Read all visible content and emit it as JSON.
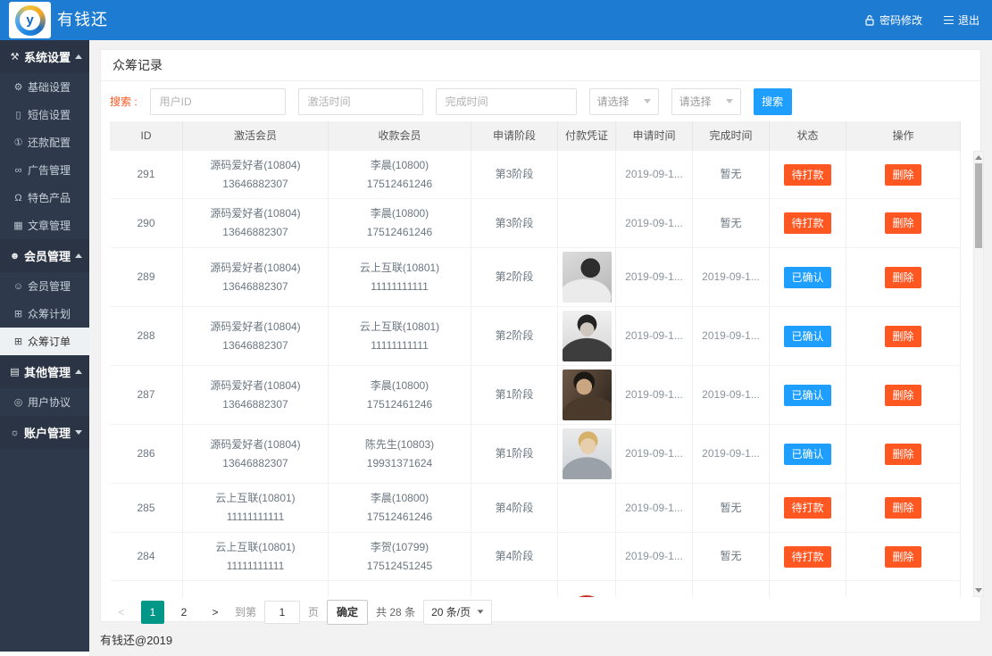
{
  "colors": {
    "header_bg": "#1E7BD2",
    "sidebar_bg": "#2E3A4C",
    "accent_blue": "#1E9FFF",
    "danger_orange": "#FF5722",
    "pager_green": "#009688"
  },
  "header": {
    "title": "有钱还",
    "logo_letter": "y",
    "password_label": "密码修改",
    "logout_label": "退出"
  },
  "sidebar": {
    "groups": [
      {
        "label": "系统设置",
        "icon": "tools-icon",
        "glyph": "⚒",
        "children": [
          {
            "label": "基础设置",
            "icon": "gear-icon",
            "glyph": "⚙"
          },
          {
            "label": "短信设置",
            "icon": "phone-icon",
            "glyph": "▯"
          },
          {
            "label": "还款配置",
            "icon": "repayment-icon",
            "glyph": "①"
          },
          {
            "label": "广告管理",
            "icon": "link-icon",
            "glyph": "∞"
          },
          {
            "label": "特色产品",
            "icon": "bell-icon",
            "glyph": "Ω"
          },
          {
            "label": "文章管理",
            "icon": "articles-icon",
            "glyph": "▦"
          }
        ]
      },
      {
        "label": "会员管理",
        "icon": "members-icon",
        "glyph": "☻",
        "children": [
          {
            "label": "会员管理",
            "icon": "user-icon",
            "glyph": "☺"
          },
          {
            "label": "众筹计划",
            "icon": "plan-icon",
            "glyph": "⊞"
          },
          {
            "label": "众筹订单",
            "icon": "orders-icon",
            "glyph": "⊞",
            "active": true
          }
        ]
      },
      {
        "label": "其他管理",
        "icon": "other-icon",
        "glyph": "▤",
        "children": [
          {
            "label": "用户协议",
            "icon": "agreement-icon",
            "glyph": "◎"
          }
        ]
      },
      {
        "label": "账户管理",
        "icon": "account-icon",
        "glyph": "☼",
        "children": []
      }
    ]
  },
  "main": {
    "page_title": "众筹记录",
    "search": {
      "label": "搜索 :",
      "fields": [
        {
          "placeholder": "用户ID"
        },
        {
          "placeholder": "激活时间"
        },
        {
          "placeholder": "完成时间"
        }
      ],
      "selects": [
        {
          "value": "请选择"
        },
        {
          "value": "请选择"
        }
      ],
      "button": "搜索"
    },
    "table": {
      "columns": [
        "ID",
        "激活会员",
        "收款会员",
        "申请阶段",
        "付款凭证",
        "申请时间",
        "完成时间",
        "状态",
        "操作"
      ],
      "rows": [
        {
          "id": "291",
          "activator_name": "源码爱好者(10804)",
          "activator_phone": "13646882307",
          "payee_name": "李晨(10800)",
          "payee_phone": "17512461246",
          "stage": "第3阶段",
          "apply_time": "2019-09-1...",
          "finish_time": "暂无",
          "status_label": "待打款",
          "status_class": "badge badge-orange",
          "action_label": "删除"
        },
        {
          "id": "290",
          "activator_name": "源码爱好者(10804)",
          "activator_phone": "13646882307",
          "payee_name": "李晨(10800)",
          "payee_phone": "17512461246",
          "stage": "第3阶段",
          "apply_time": "2019-09-1...",
          "finish_time": "暂无",
          "status_label": "待打款",
          "status_class": "badge badge-orange",
          "action_label": "删除"
        },
        {
          "id": "289",
          "activator_name": "源码爱好者(10804)",
          "activator_phone": "13646882307",
          "payee_name": "云上互联(10801)",
          "payee_phone": "11111111111",
          "stage": "第2阶段",
          "voucher_class": "photo photo-a",
          "apply_time": "2019-09-1...",
          "finish_time": "2019-09-1...",
          "status_label": "已确认",
          "status_class": "badge badge-blue",
          "action_label": "删除"
        },
        {
          "id": "288",
          "activator_name": "源码爱好者(10804)",
          "activator_phone": "13646882307",
          "payee_name": "云上互联(10801)",
          "payee_phone": "11111111111",
          "stage": "第2阶段",
          "voucher_class": "photo photo-b",
          "apply_time": "2019-09-1...",
          "finish_time": "2019-09-1...",
          "status_label": "已确认",
          "status_class": "badge badge-blue",
          "action_label": "删除"
        },
        {
          "id": "287",
          "activator_name": "源码爱好者(10804)",
          "activator_phone": "13646882307",
          "payee_name": "李晨(10800)",
          "payee_phone": "17512461246",
          "stage": "第1阶段",
          "voucher_class": "photo photo-c",
          "apply_time": "2019-09-1...",
          "finish_time": "2019-09-1...",
          "status_label": "已确认",
          "status_class": "badge badge-blue",
          "action_label": "删除"
        },
        {
          "id": "286",
          "activator_name": "源码爱好者(10804)",
          "activator_phone": "13646882307",
          "payee_name": "陈先生(10803)",
          "payee_phone": "19931371624",
          "stage": "第1阶段",
          "voucher_class": "photo photo-d",
          "apply_time": "2019-09-1...",
          "finish_time": "2019-09-1...",
          "status_label": "已确认",
          "status_class": "badge badge-blue",
          "action_label": "删除"
        },
        {
          "id": "285",
          "activator_name": "云上互联(10801)",
          "activator_phone": "11111111111",
          "payee_name": "李晨(10800)",
          "payee_phone": "17512461246",
          "stage": "第4阶段",
          "apply_time": "2019-09-1...",
          "finish_time": "暂无",
          "status_label": "待打款",
          "status_class": "badge badge-orange",
          "action_label": "删除"
        },
        {
          "id": "284",
          "activator_name": "云上互联(10801)",
          "activator_phone": "11111111111",
          "payee_name": "李贺(10799)",
          "payee_phone": "17512451245",
          "stage": "第4阶段",
          "apply_time": "2019-09-1...",
          "finish_time": "暂无",
          "status_label": "待打款",
          "status_class": "badge badge-orange",
          "action_label": "删除"
        }
      ]
    },
    "pagination": {
      "prev": "<",
      "pages": [
        "1",
        "2"
      ],
      "next": ">",
      "goto_label": "到第",
      "page_value": "1",
      "page_unit": "页",
      "confirm_label": "确定",
      "total_label": "共 28 条",
      "page_size_label": "20 条/页"
    },
    "footer": "有钱还@2019"
  }
}
